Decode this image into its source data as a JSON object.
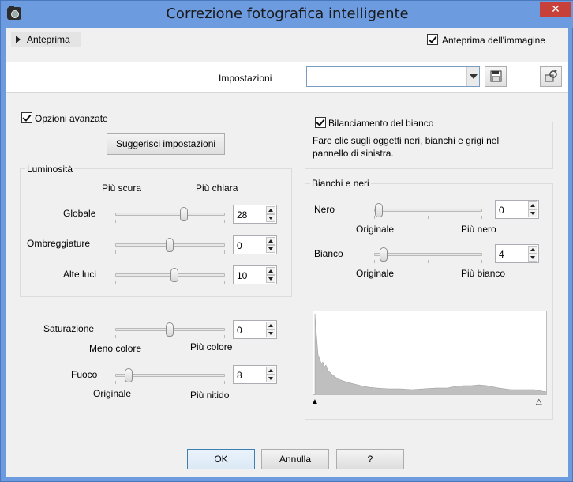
{
  "window": {
    "title": "Correzione fotografica intelligente",
    "close_glyph": "✕"
  },
  "preview": {
    "toggle_label": "Anteprima",
    "image_preview_label": "Anteprima dell'immagine",
    "image_preview_checked": true
  },
  "settings": {
    "label": "Impostazioni",
    "value": "",
    "save_icon": "save-icon",
    "reset_icon": "reset-icon"
  },
  "advanced": {
    "label": "Opzioni avanzate",
    "checked": true,
    "suggest_label": "Suggerisci impostazioni"
  },
  "luminosity": {
    "group_label": "Luminosità",
    "left_label": "Più scura",
    "right_label": "Più chiara",
    "rows": [
      {
        "label": "Globale",
        "value": "28"
      },
      {
        "label": "Ombreggiature",
        "value": "0"
      },
      {
        "label": "Alte luci",
        "value": "10"
      }
    ]
  },
  "saturation": {
    "label": "Saturazione",
    "value": "0",
    "left_label": "Meno colore",
    "right_label": "Più colore"
  },
  "focus": {
    "label": "Fuoco",
    "value": "8",
    "left_label": "Originale",
    "right_label": "Più nitido"
  },
  "white_balance": {
    "label": "Bilanciamento del bianco",
    "checked": true,
    "description_line1": "Fare clic sugli oggetti neri, bianchi e grigi nel",
    "description_line2": "pannello di sinistra."
  },
  "black_white": {
    "group_label": "Bianchi e neri",
    "black": {
      "label": "Nero",
      "value": "0",
      "left_label": "Originale",
      "right_label": "Più nero"
    },
    "white": {
      "label": "Bianco",
      "value": "4",
      "left_label": "Originale",
      "right_label": "Più bianco"
    }
  },
  "histogram": {
    "black_marker": "▲",
    "white_marker": "△"
  },
  "buttons": {
    "ok": "OK",
    "cancel": "Annulla",
    "help": "?"
  }
}
